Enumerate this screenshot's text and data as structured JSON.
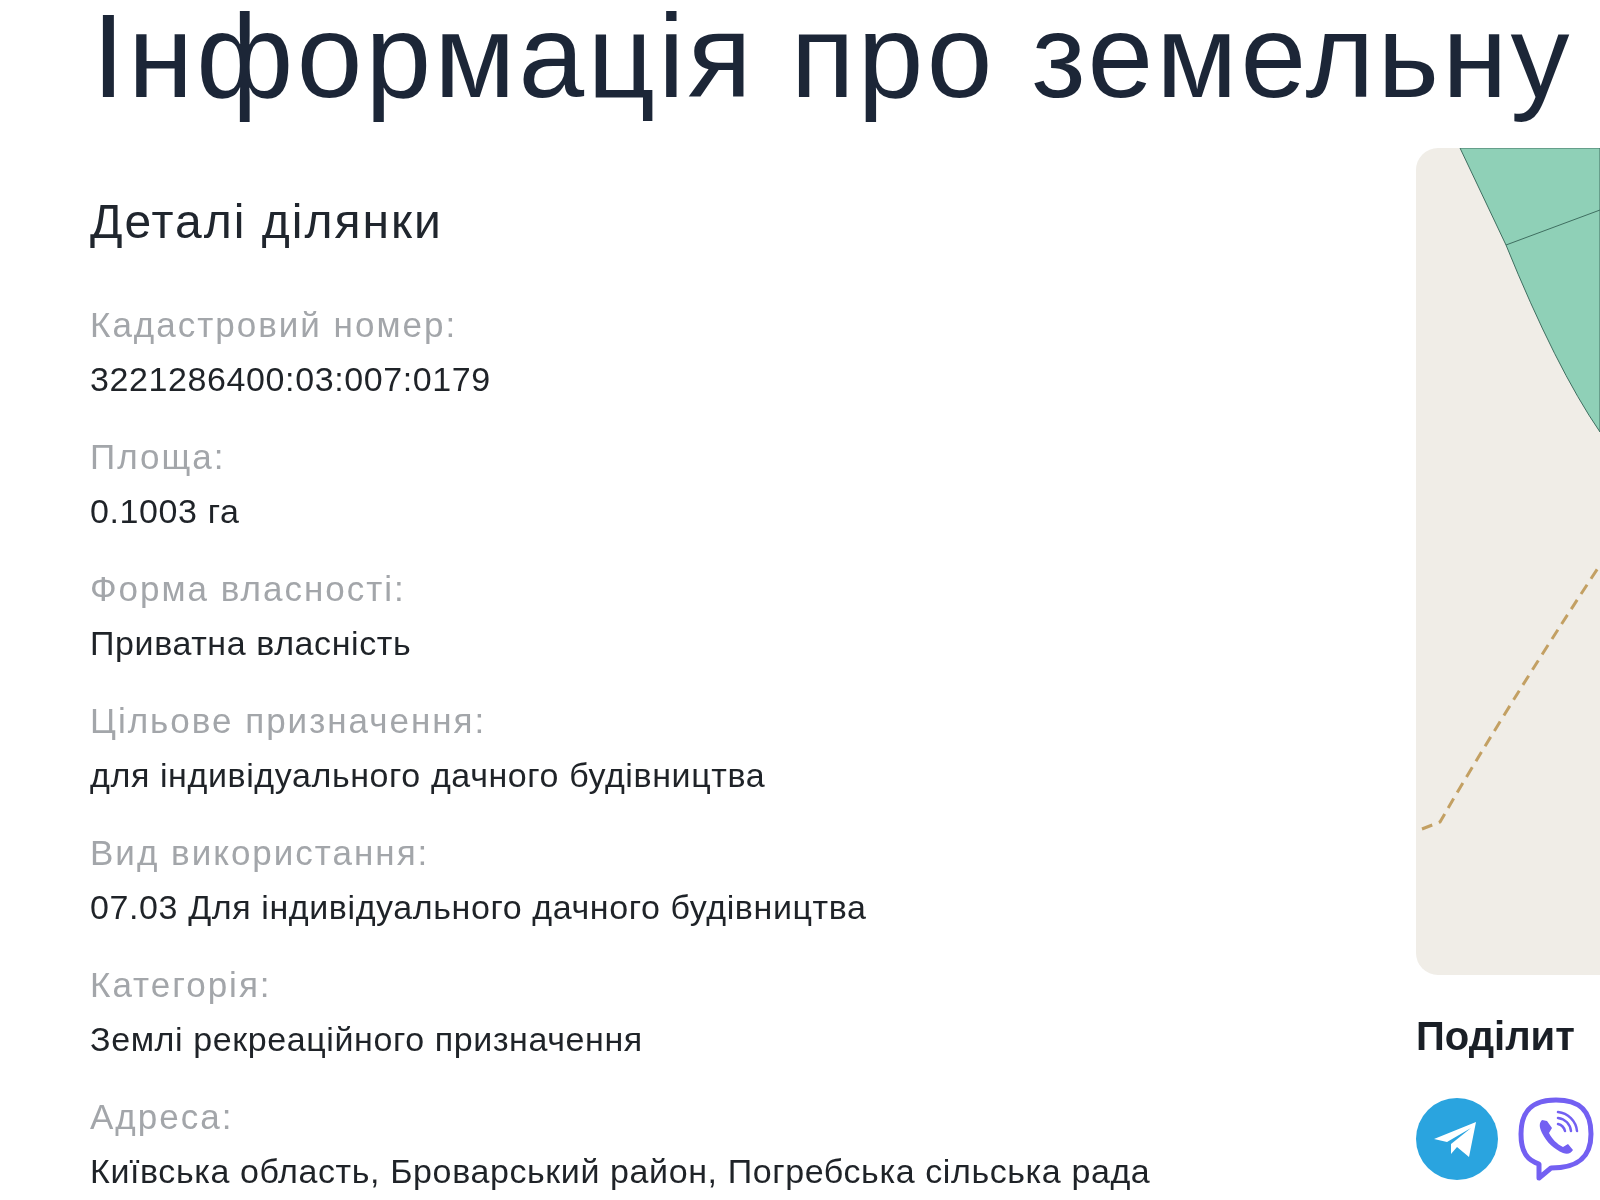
{
  "page": {
    "title": "Інформація про земельну"
  },
  "details": {
    "heading": "Деталі ділянки",
    "fields": [
      {
        "label": "Кадастровий номер:",
        "value": "3221286400:03:007:0179"
      },
      {
        "label": "Площа:",
        "value": "0.1003 га"
      },
      {
        "label": "Форма власності:",
        "value": "Приватна власність"
      },
      {
        "label": "Цільове призначення:",
        "value": "для індивідуального дачного будівництва"
      },
      {
        "label": "Вид використання:",
        "value": "07.03 Для індивідуального дачного будівництва"
      },
      {
        "label": "Категорія:",
        "value": "Землі рекреаційного призначення"
      },
      {
        "label": "Адреса:",
        "value": "Київська область, Броварський район, Погребська сільська рада"
      }
    ]
  },
  "share": {
    "heading": "Поділит",
    "buttons": [
      {
        "kind": "plane"
      },
      {
        "kind": "phone"
      }
    ]
  }
}
